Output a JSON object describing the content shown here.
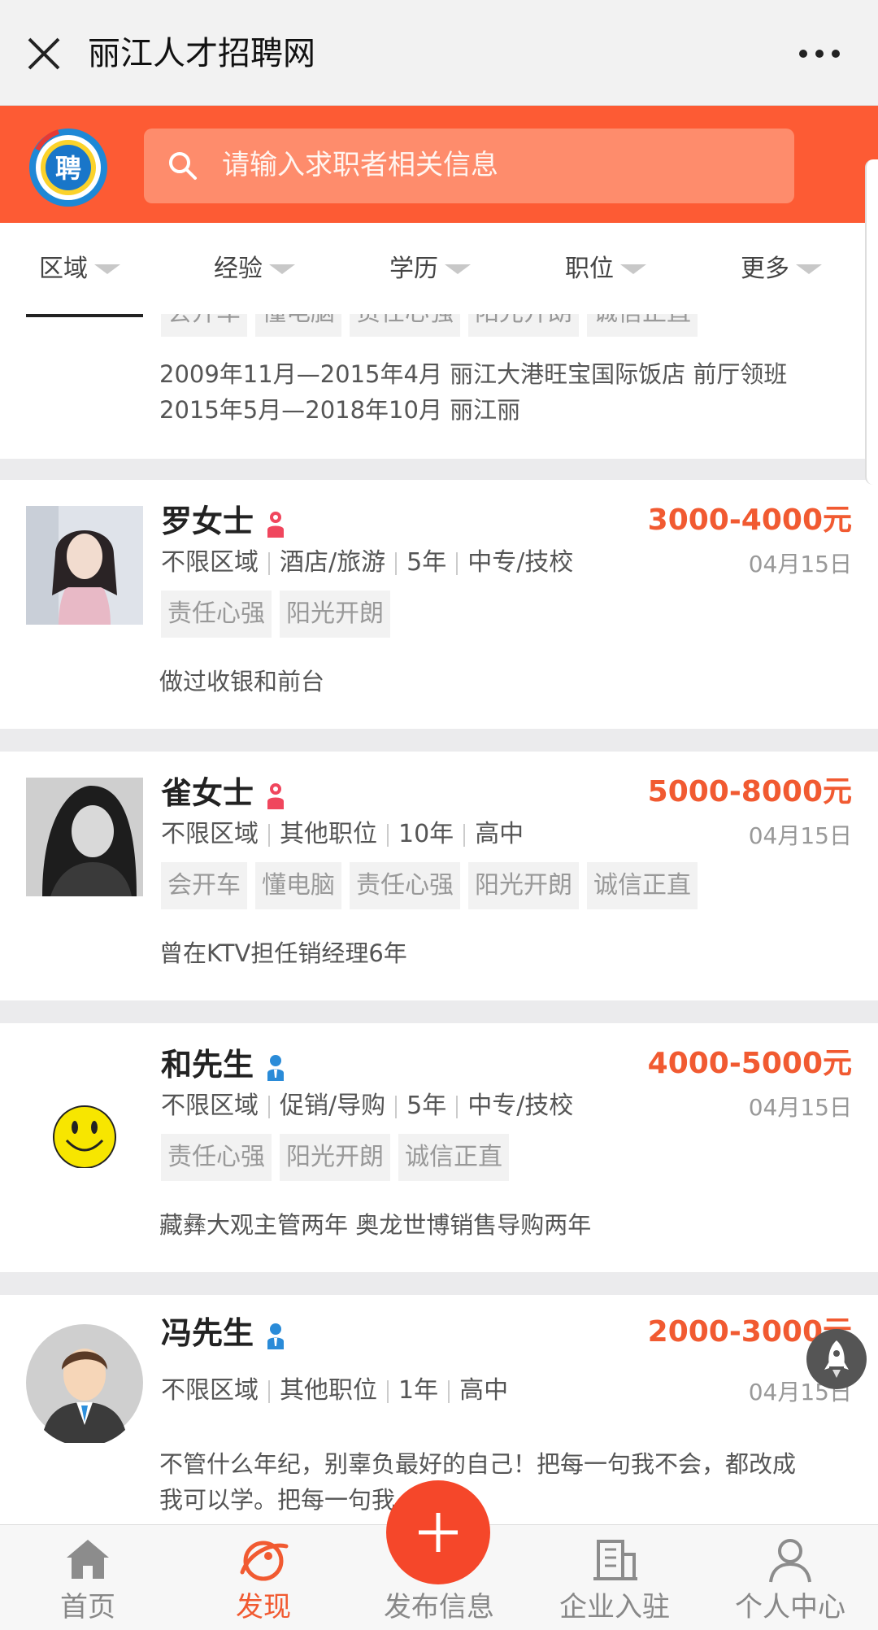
{
  "titlebar": {
    "title": "丽江人才招聘网"
  },
  "search": {
    "placeholder": "请输入求职者相关信息",
    "logo_char": "聘"
  },
  "filters": [
    "区域",
    "经验",
    "学历",
    "职位",
    "更多"
  ],
  "partial_card": {
    "tags": [
      "会开车",
      "懂电脑",
      "责任心强",
      "阳光开朗",
      "诚信正直"
    ],
    "desc_lines": [
      "2009年11月—2015年4月 丽江大港旺宝国际饭店 前厅领班",
      "2015年5月—2018年10月 丽江丽"
    ]
  },
  "cards": [
    {
      "name": "罗女士",
      "gender": "female",
      "salary": "3000-4000元",
      "date": "04月15日",
      "info": [
        "不限区域",
        "酒店/旅游",
        "5年",
        "中专/技校"
      ],
      "tags": [
        "责任心强",
        "阳光开朗"
      ],
      "desc": "做过收银和前台"
    },
    {
      "name": "雀女士",
      "gender": "female",
      "salary": "5000-8000元",
      "date": "04月15日",
      "info": [
        "不限区域",
        "其他职位",
        "10年",
        "高中"
      ],
      "tags": [
        "会开车",
        "懂电脑",
        "责任心强",
        "阳光开朗",
        "诚信正直"
      ],
      "desc": "曾在KTV担任销经理6年"
    },
    {
      "name": "和先生",
      "gender": "male",
      "salary": "4000-5000元",
      "date": "04月15日",
      "info": [
        "不限区域",
        "促销/导购",
        "5年",
        "中专/技校"
      ],
      "tags": [
        "责任心强",
        "阳光开朗",
        "诚信正直"
      ],
      "desc": "藏彝大观主管两年 奥龙世博销售导购两年"
    },
    {
      "name": "冯先生",
      "gender": "male",
      "salary": "2000-3000元",
      "date": "04月15日",
      "info": [
        "不限区域",
        "其他职位",
        "1年",
        "高中"
      ],
      "tags": [],
      "desc_lines": [
        "不管什么年纪，别辜负最好的自己！把每一句我不会，都改成",
        "我可以学。把每一句我"
      ]
    }
  ],
  "bottom_nav": [
    {
      "label": "首页",
      "icon": "home-icon"
    },
    {
      "label": "发现",
      "icon": "discover-icon"
    },
    {
      "label": "发布信息",
      "icon": "plus-icon"
    },
    {
      "label": "企业入驻",
      "icon": "building-icon"
    },
    {
      "label": "个人中心",
      "icon": "person-icon"
    }
  ],
  "colors": {
    "brand": "#fd5b34",
    "salary": "#f15a31",
    "active_tab": "#f15a31"
  }
}
